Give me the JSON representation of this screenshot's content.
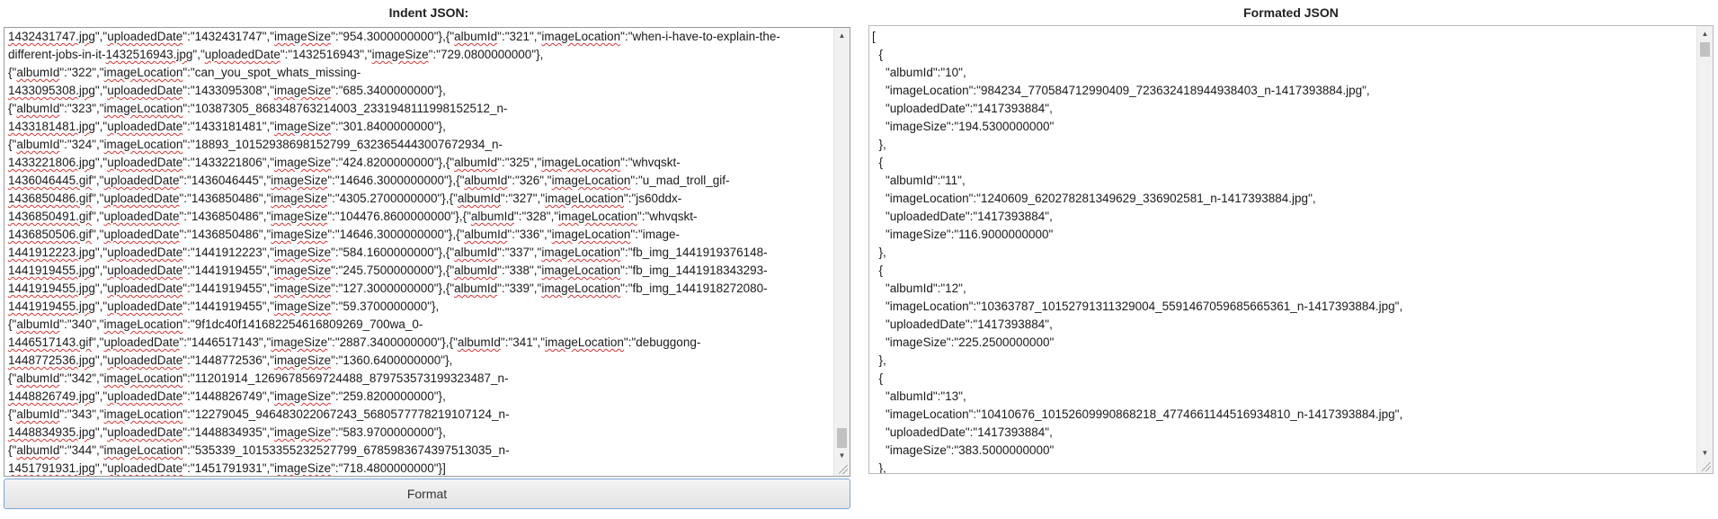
{
  "left_panel": {
    "title": "Indent JSON:",
    "lines": [
      "1432431747.jpg\",\"uploadedDate\":\"1432431747\",\"imageSize\":\"954.3000000000\"},{\"albumId\":\"321\",\"imageLocation\":\"when-i-have-to-explain-the-",
      "different-jobs-in-it-1432516943.jpg\",\"uploadedDate\":\"1432516943\",\"imageSize\":\"729.0800000000\"},",
      "{\"albumId\":\"322\",\"imageLocation\":\"can_you_spot_whats_missing-",
      "1433095308.jpg\",\"uploadedDate\":\"1433095308\",\"imageSize\":\"685.3400000000\"},",
      "{\"albumId\":\"323\",\"imageLocation\":\"10387305_868348763214003_2331948111998152512_n-",
      "1433181481.jpg\",\"uploadedDate\":\"1433181481\",\"imageSize\":\"301.8400000000\"},",
      "{\"albumId\":\"324\",\"imageLocation\":\"18893_10152938698152799_6323654443007672934_n-",
      "1433221806.jpg\",\"uploadedDate\":\"1433221806\",\"imageSize\":\"424.8200000000\"},{\"albumId\":\"325\",\"imageLocation\":\"whvqskt-",
      "1436046445.gif\",\"uploadedDate\":\"1436046445\",\"imageSize\":\"14646.3000000000\"},{\"albumId\":\"326\",\"imageLocation\":\"u_mad_troll_gif-",
      "1436850486.gif\",\"uploadedDate\":\"1436850486\",\"imageSize\":\"4305.2700000000\"},{\"albumId\":\"327\",\"imageLocation\":\"js60ddx-",
      "1436850491.gif\",\"uploadedDate\":\"1436850486\",\"imageSize\":\"104476.8600000000\"},{\"albumId\":\"328\",\"imageLocation\":\"whvqskt-",
      "1436850506.gif\",\"uploadedDate\":\"1436850486\",\"imageSize\":\"14646.3000000000\"},{\"albumId\":\"336\",\"imageLocation\":\"image-",
      "1441912223.jpg\",\"uploadedDate\":\"1441912223\",\"imageSize\":\"584.1600000000\"},{\"albumId\":\"337\",\"imageLocation\":\"fb_img_1441919376148-",
      "1441919455.jpg\",\"uploadedDate\":\"1441919455\",\"imageSize\":\"245.7500000000\"},{\"albumId\":\"338\",\"imageLocation\":\"fb_img_1441918343293-",
      "1441919455.jpg\",\"uploadedDate\":\"1441919455\",\"imageSize\":\"127.3000000000\"},{\"albumId\":\"339\",\"imageLocation\":\"fb_img_1441918272080-",
      "1441919455.jpg\",\"uploadedDate\":\"1441919455\",\"imageSize\":\"59.3700000000\"},",
      "{\"albumId\":\"340\",\"imageLocation\":\"9f1dc40f141682254616809269_700wa_0-",
      "1446517143.gif\",\"uploadedDate\":\"1446517143\",\"imageSize\":\"2887.3400000000\"},{\"albumId\":\"341\",\"imageLocation\":\"debuggong-",
      "1448772536.jpg\",\"uploadedDate\":\"1448772536\",\"imageSize\":\"1360.6400000000\"},",
      "{\"albumId\":\"342\",\"imageLocation\":\"11201914_1269678569724488_879753573199323487_n-",
      "1448826749.jpg\",\"uploadedDate\":\"1448826749\",\"imageSize\":\"259.8200000000\"},",
      "{\"albumId\":\"343\",\"imageLocation\":\"12279045_946483022067243_5680577778219107124_n-",
      "1448834935.jpg\",\"uploadedDate\":\"1448834935\",\"imageSize\":\"583.9700000000\"},",
      "{\"albumId\":\"344\",\"imageLocation\":\"535339_10153355232527799_6785983674397513035_n-",
      "1451791931.jpg\",\"uploadedDate\":\"1451791931\",\"imageSize\":\"718.4800000000\"}]"
    ]
  },
  "right_panel": {
    "title": "Formated JSON",
    "lines": [
      "[",
      "  {",
      "    \"albumId\":\"10\",",
      "    \"imageLocation\":\"984234_770584712990409_723632418944938403_n-1417393884.jpg\",",
      "    \"uploadedDate\":\"1417393884\",",
      "    \"imageSize\":\"194.5300000000\"",
      "  },",
      "  {",
      "    \"albumId\":\"11\",",
      "    \"imageLocation\":\"1240609_620278281349629_336902581_n-1417393884.jpg\",",
      "    \"uploadedDate\":\"1417393884\",",
      "    \"imageSize\":\"116.9000000000\"",
      "  },",
      "  {",
      "    \"albumId\":\"12\",",
      "    \"imageLocation\":\"10363787_10152791311329004_5591467059685665361_n-1417393884.jpg\",",
      "    \"uploadedDate\":\"1417393884\",",
      "    \"imageSize\":\"225.2500000000\"",
      "  },",
      "  {",
      "    \"albumId\":\"13\",",
      "    \"imageLocation\":\"10410676_10152609990868218_4774661144516934810_n-1417393884.jpg\",",
      "    \"uploadedDate\":\"1417393884\",",
      "    \"imageSize\":\"383.5000000000\"",
      "  },"
    ]
  },
  "format_button": {
    "label": "Format"
  },
  "icons": {
    "scroll_up": "scroll-up-arrow-icon",
    "scroll_down": "scroll-down-arrow-icon",
    "resize": "resize-grip-icon"
  },
  "colors": {
    "button_border": "#7aa7d6",
    "spellcheck_underline": "#dd3333"
  }
}
